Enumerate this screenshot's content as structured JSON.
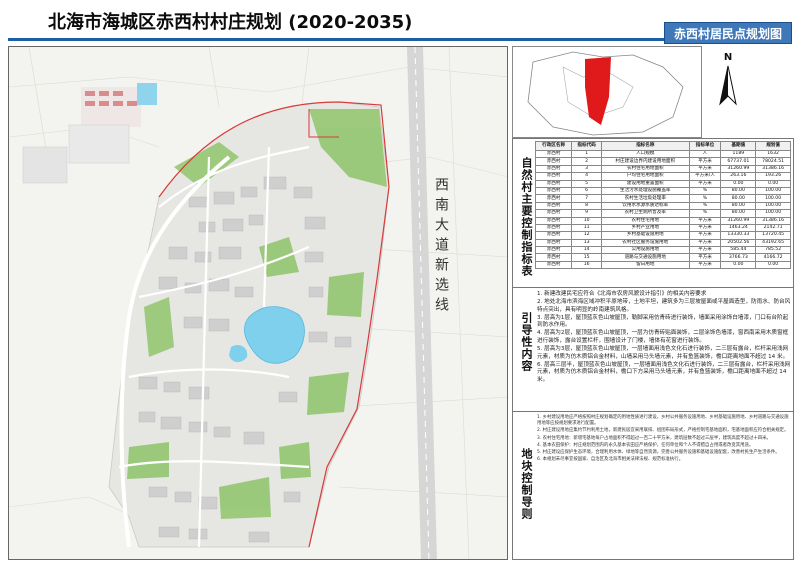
{
  "header": {
    "title": "北海市海城区赤西村村庄规划 (2020-2035)",
    "badge": "赤西村居民点规划图"
  },
  "map": {
    "road_label": "西南大道新选线",
    "colors": {
      "accent": "#1d5fa6",
      "residential": "#e8e8e8",
      "green": "#8fc46a",
      "water": "#7fd0ec",
      "road": "#ffffff",
      "boundary": "#d83a3a",
      "farmland": "#d9d6c8"
    }
  },
  "locator": {
    "highlight_color": "#e01a1a",
    "north": "N"
  },
  "sections": {
    "control_label": "自然村主要控制指标表",
    "guide_label": "引导性内容",
    "plot_label": "地块控制导则"
  },
  "control_table": {
    "headers": [
      "行政区名称",
      "指标代码",
      "指标名称",
      "指标单位",
      "基期值",
      "规划值"
    ],
    "rows": [
      [
        "赤西村",
        "1",
        "人口规模",
        "人",
        "1189",
        "1632"
      ],
      [
        "赤西村",
        "2",
        "村庄建设边界内建设用地面积",
        "平方米",
        "67737.01",
        "78024.51"
      ],
      [
        "赤西村",
        "3",
        "农村住宅用地面积",
        "平方米",
        "31260.99",
        "31386.16"
      ],
      [
        "赤西村",
        "4",
        "户均住宅用地面积",
        "平方米/人",
        "263.16",
        "193.26"
      ],
      [
        "赤西村",
        "5",
        "建设用地重置面积",
        "平方米",
        "0.00",
        "0.00"
      ],
      [
        "赤西村",
        "6",
        "生活污水处理设施覆盖率",
        "%",
        "80.00",
        "100.00"
      ],
      [
        "赤西村",
        "7",
        "农村生活垃圾处理率",
        "%",
        "80.00",
        "100.00"
      ],
      [
        "赤西村",
        "8",
        "饮用水水源水质达标率",
        "%",
        "80.00",
        "100.00"
      ],
      [
        "赤西村",
        "9",
        "农村卫生厕所普及率",
        "%",
        "80.00",
        "100.00"
      ],
      [
        "赤西村",
        "10",
        "农村住宅用地",
        "平方米",
        "31260.99",
        "31386.16"
      ],
      [
        "赤西村",
        "11",
        "乡村产业用地",
        "平方米",
        "1463.24",
        "2142.71"
      ],
      [
        "赤西村",
        "12",
        "乡村基础设施用地",
        "平方米",
        "13330.33",
        "13720.45"
      ],
      [
        "赤西村",
        "13",
        "农村社区服务设施用地",
        "平方米",
        "20502.56",
        "43192.65"
      ],
      [
        "赤西村",
        "14",
        "公用设施用地",
        "平方米",
        "585.44",
        "785.52"
      ],
      [
        "赤西村",
        "15",
        "道路与交通设施用地",
        "平方米",
        "3766.73",
        "4166.72"
      ],
      [
        "赤西村",
        "16",
        "留白用地",
        "平方米",
        "0.00",
        "0.00"
      ]
    ]
  },
  "guide_items": [
    "1. 新建改建民宅应符合《北海市农房风貌设计指引》的相关内容要求",
    "2. 地处北海市滨海区域冲积平原地带，土地平坦，建筑多为三层坡屋面或平屋面造型，防雨水、防台风特点突出，具有明显的岭南建筑风格。",
    "3. 层高为1层，屋顶蓝灰色山坡屋顶，勒脚采用仿青砖进行装饰，墙面采用涂饰白墙漆，门口有台阶起到防水作用。",
    "4. 层高为2层，屋顶蓝灰色山坡屋顶，一层为仿青砖贴面装饰，二层涂饰色墙漆，窗西南采用木质窗框进行装饰，露台设置栏杆，围墙设计了门楼，墙体有花窗进行装饰。",
    "5. 层高为3层，屋顶蓝灰色山坡屋顶，一层墙面用浅色文化石进行装饰，二三层有露台，栏杆采用浅网元素，材质为仿木质铝合金材料，山墙采用马头墙元素，并有鱼篮装饰，檐口距离地面不超过 14 米。",
    "6. 层高三层半，屋顶蓝灰色山坡屋顶，一层墙面用浅色文化石进行装饰，二三层有露台，栏杆采用浅网元素，材质为仿木质铝合金材料，檐口下方采用马头墙元素，并有鱼篮装饰，檐口距离地面不超过 14 米。"
  ],
  "plot_items": [
    "1. 乡村建设用地应严格按照村庄规划确定的用地性质进行建设，乡村公共服务设施用地、乡村基础设施用地、乡村道路与交通设施用地等应按规划要求进行配置。",
    "2. 村庄建设用地应集约节约利用土地，新建民居宜采用联排、组团布局形式，严格控制宅基地面积，宅基地面积应符合相关规定。",
    "3. 农村住宅用地：新增宅基地每户占地面积不得超过一百二十平方米，建筑层数不超过三层半，建筑高度不超过十四米。",
    "4. 基本农田保护：村庄规划范围内的永久基本农田应严格保护，任何单位和个人不得擅自占用或者改变其用途。",
    "5. 村庄建设应保护生态环境，合理利用水体、绿地等自然资源，完善公共服务设施和基础设施配套，改善村民生产生活条件。",
    "6. 本规划未尽事宜按国家、自治区及北海市相关法律法规、规范标准执行。"
  ]
}
